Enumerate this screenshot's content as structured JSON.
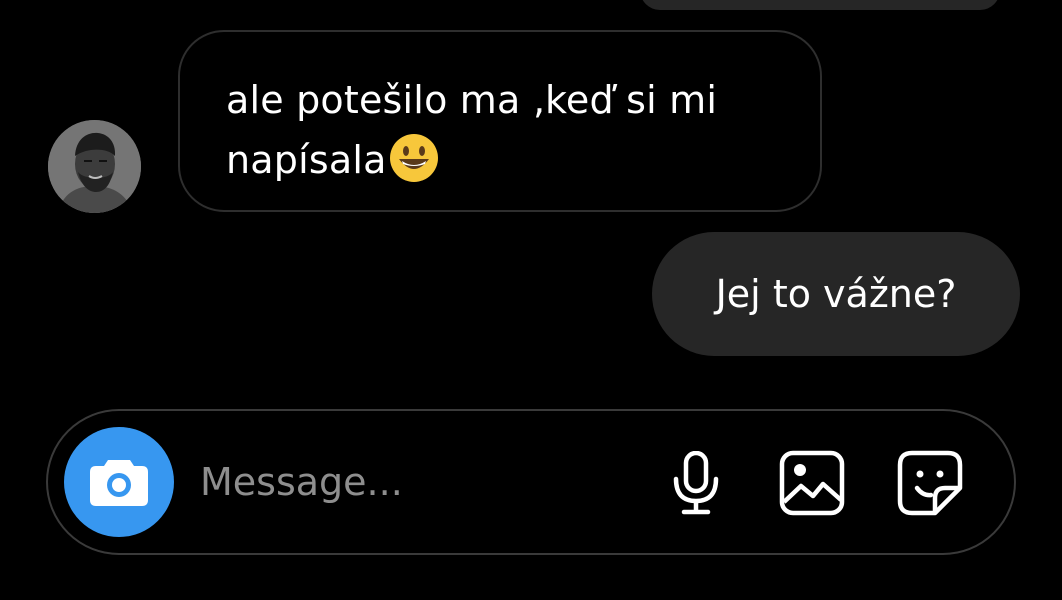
{
  "chat": {
    "messages": [
      {
        "direction": "incoming",
        "text_line1": "ale potešilo ma ‚keď si mi",
        "text_line2": "napísala",
        "emoji": "grinning-face"
      },
      {
        "direction": "outgoing",
        "text": "Jej to vážne?"
      }
    ],
    "sender_avatar": "avatar-photo"
  },
  "composer": {
    "placeholder": "Message...",
    "value": "",
    "camera_icon": "camera-icon",
    "mic_icon": "microphone-icon",
    "gallery_icon": "image-gallery-icon",
    "sticker_icon": "sticker-icon"
  },
  "colors": {
    "background": "#000000",
    "bubble_outgoing": "#262626",
    "bubble_incoming_border": "#2e2e2e",
    "accent": "#3797f0",
    "placeholder": "#8e8e8e"
  }
}
